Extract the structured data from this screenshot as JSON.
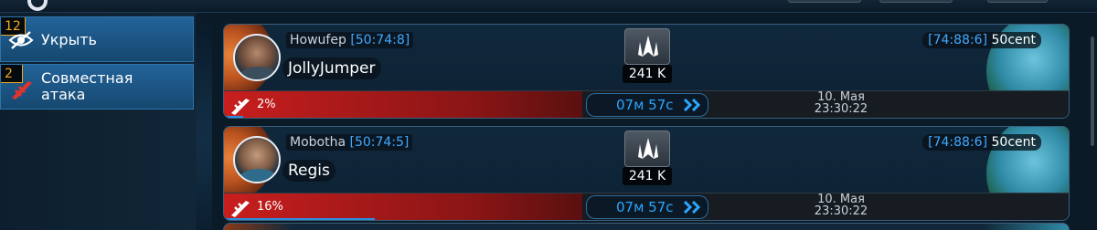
{
  "sidebar": {
    "hide": {
      "count": "12",
      "label": "Укрыть",
      "icon": "hidden-eye-icon"
    },
    "joint_attack": {
      "count": "2",
      "label_line1": "Совместная",
      "label_line2": "атака",
      "icon": "sword-icon"
    }
  },
  "attacks": [
    {
      "attacker": "Howufep",
      "attacker_coords": "[50:74:8]",
      "nickname": "JollyJumper",
      "ships": "241 K",
      "target_coords": "[74:88:6]",
      "target_name": "50cent",
      "progress": "2%",
      "progress_fraction": 0.02,
      "timer": "07м 57с",
      "arrival_date": "10. Мая",
      "arrival_time": "23:30:22"
    },
    {
      "attacker": "Mobotha",
      "attacker_coords": "[50:74:5]",
      "nickname": "Regis",
      "ships": "241 K",
      "target_coords": "[74:88:6]",
      "target_name": "50cent",
      "progress": "16%",
      "progress_fraction": 0.16,
      "timer": "07м 57с",
      "arrival_date": "10. Мая",
      "arrival_time": "23:30:22"
    }
  ],
  "colors": {
    "accent_blue": "#2ca6ff",
    "badge_orange": "#f2a81d",
    "attack_red": "#c81e1e"
  }
}
